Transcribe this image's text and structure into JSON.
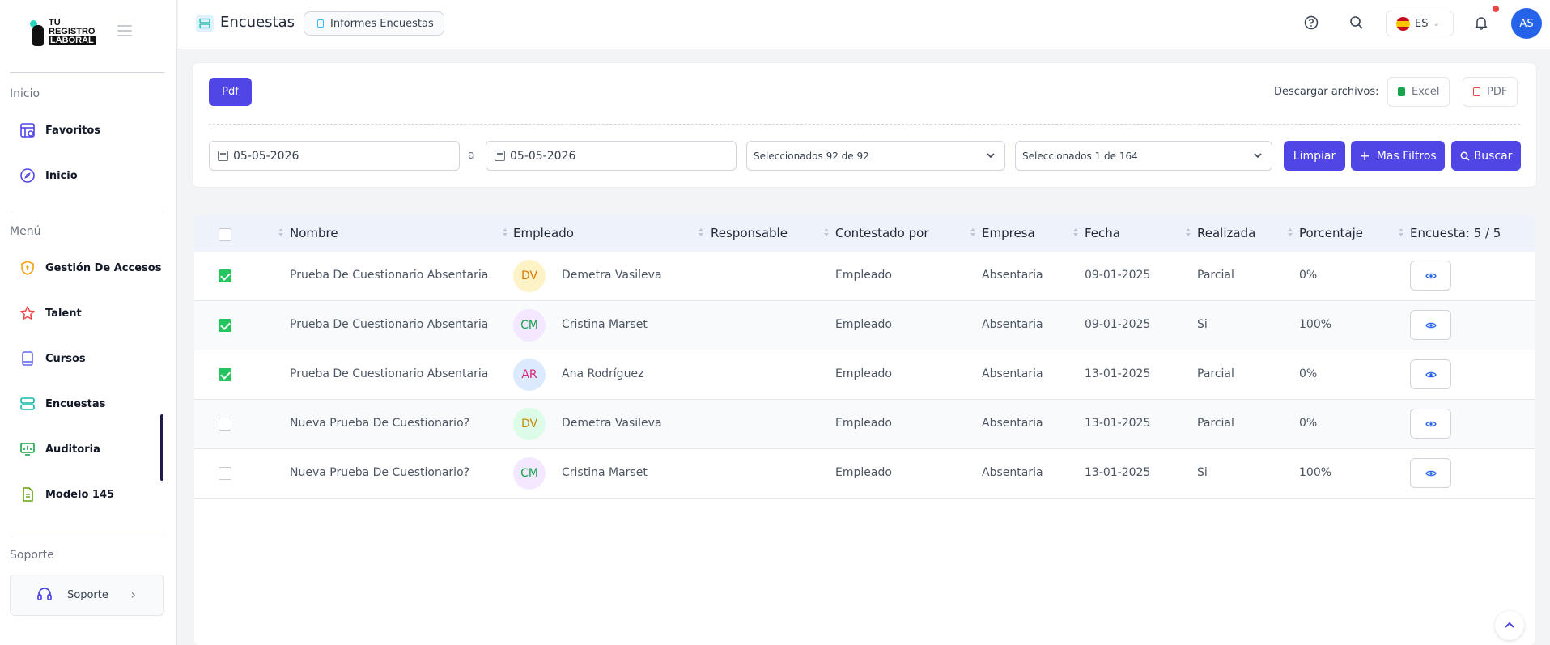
{
  "brand": {
    "line1": "TU",
    "line2": "REGISTRO",
    "line3": "LABORAL"
  },
  "sidebar": {
    "section_inicio": "Inicio",
    "section_menu": "Menú",
    "section_soporte": "Soporte",
    "items": [
      {
        "label": "Favoritos",
        "icon": "favorites-grid-icon"
      },
      {
        "label": "Inicio",
        "icon": "compass-icon"
      },
      {
        "label": "Gestión De Accesos",
        "icon": "shield-icon"
      },
      {
        "label": "Talent",
        "icon": "star-icon"
      },
      {
        "label": "Cursos",
        "icon": "book-icon"
      },
      {
        "label": "Encuestas",
        "icon": "server-icon"
      },
      {
        "label": "Auditoria",
        "icon": "monitor-chart-icon"
      },
      {
        "label": "Modelo 145",
        "icon": "document-icon"
      }
    ],
    "support_label": "Soporte"
  },
  "topbar": {
    "title": "Encuestas",
    "breadcrumb": "Informes Encuestas",
    "language": "ES",
    "user_initials": "AS"
  },
  "filters": {
    "pdf_button": "Pdf",
    "download_label": "Descargar archivos:",
    "excel_label": "Excel",
    "pdf_label": "PDF",
    "date_from": "05-05-2026",
    "date_separator": "a",
    "date_to": "05-05-2026",
    "select_1": "Seleccionados 92 de 92",
    "select_2": "Seleccionados 1 de 164",
    "clear_button": "Limpiar",
    "more_filters_button": "Mas Filtros",
    "search_button": "Buscar"
  },
  "table": {
    "headers": {
      "nombre": "Nombre",
      "empleado": "Empleado",
      "responsable": "Responsable",
      "contestado": "Contestado por",
      "empresa": "Empresa",
      "fecha": "Fecha",
      "realizada": "Realizada",
      "porcentaje": "Porcentaje",
      "encuesta": "Encuesta: 5 / 5"
    },
    "rows": [
      {
        "checked": true,
        "nombre": "Prueba De Cuestionario Absentaria",
        "initials": "DV",
        "avatar_bg": "#fef3c7",
        "avatar_fg": "#d97706",
        "empleado": "Demetra Vasileva",
        "responsable": "",
        "contestado": "Empleado",
        "empresa": "Absentaria",
        "fecha": "09-01-2025",
        "realizada": "Parcial",
        "porcentaje": "0%"
      },
      {
        "checked": true,
        "nombre": "Prueba De Cuestionario Absentaria",
        "initials": "CM",
        "avatar_bg": "#f3e8ff",
        "avatar_fg": "#16a34a",
        "empleado": "Cristina Marset",
        "responsable": "",
        "contestado": "Empleado",
        "empresa": "Absentaria",
        "fecha": "09-01-2025",
        "realizada": "Si",
        "porcentaje": "100%"
      },
      {
        "checked": true,
        "nombre": "Prueba De Cuestionario Absentaria",
        "initials": "AR",
        "avatar_bg": "#dbeafe",
        "avatar_fg": "#db2777",
        "empleado": "Ana Rodríguez",
        "responsable": "",
        "contestado": "Empleado",
        "empresa": "Absentaria",
        "fecha": "13-01-2025",
        "realizada": "Parcial",
        "porcentaje": "0%"
      },
      {
        "checked": false,
        "nombre": "Nueva Prueba De Cuestionario?",
        "initials": "DV",
        "avatar_bg": "#dcfce7",
        "avatar_fg": "#ca8a04",
        "empleado": "Demetra Vasileva",
        "responsable": "",
        "contestado": "Empleado",
        "empresa": "Absentaria",
        "fecha": "13-01-2025",
        "realizada": "Parcial",
        "porcentaje": "0%"
      },
      {
        "checked": false,
        "nombre": "Nueva Prueba De Cuestionario?",
        "initials": "CM",
        "avatar_bg": "#f3e8ff",
        "avatar_fg": "#16a34a",
        "empleado": "Cristina Marset",
        "responsable": "",
        "contestado": "Empleado",
        "empresa": "Absentaria",
        "fecha": "13-01-2025",
        "realizada": "Si",
        "porcentaje": "100%"
      }
    ]
  },
  "colors": {
    "primary": "#4f46e5",
    "check": "#22c55e",
    "header_bg": "#eef2fb"
  }
}
